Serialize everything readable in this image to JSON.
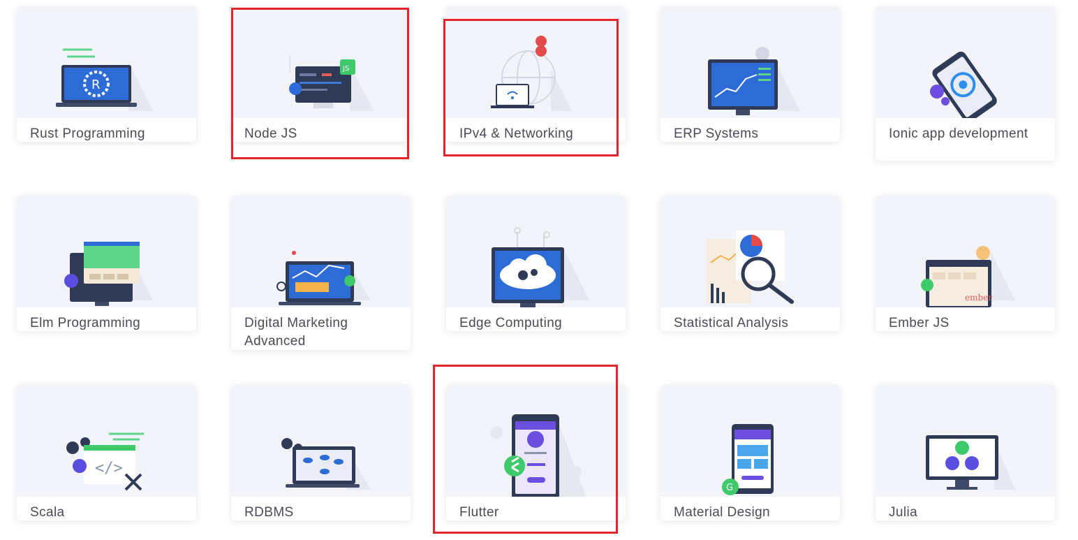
{
  "courses": [
    {
      "title": "Rust Programming",
      "icon": "rust-laptop-icon"
    },
    {
      "title": "Node JS",
      "icon": "nodejs-monitor-icon"
    },
    {
      "title": "IPv4 & Networking",
      "icon": "globe-network-icon"
    },
    {
      "title": "ERP Systems",
      "icon": "erp-dashboard-icon"
    },
    {
      "title": "Ionic app development",
      "icon": "ionic-phone-icon"
    },
    {
      "title": "Elm Programming",
      "icon": "elm-monitor-icon"
    },
    {
      "title": "Digital Marketing Advanced",
      "icon": "marketing-laptop-icon"
    },
    {
      "title": "Edge Computing",
      "icon": "cloud-monitor-icon"
    },
    {
      "title": "Statistical Analysis",
      "icon": "magnifier-charts-icon"
    },
    {
      "title": "Ember JS",
      "icon": "ember-browser-icon"
    },
    {
      "title": "Scala",
      "icon": "code-window-icon"
    },
    {
      "title": "RDBMS",
      "icon": "database-laptop-icon"
    },
    {
      "title": "Flutter",
      "icon": "flutter-phone-icon"
    },
    {
      "title": "Material Design",
      "icon": "material-phone-icon"
    },
    {
      "title": "Julia",
      "icon": "julia-monitor-icon"
    }
  ],
  "highlighted": [
    "Node JS",
    "IPv4 & Networking",
    "Flutter"
  ],
  "colors": {
    "highlight": "#e3242b",
    "card_art_bg": "#f3f4f9",
    "navy": "#2f3a56",
    "blue": "#2d6bd6",
    "green": "#3ec96b"
  }
}
